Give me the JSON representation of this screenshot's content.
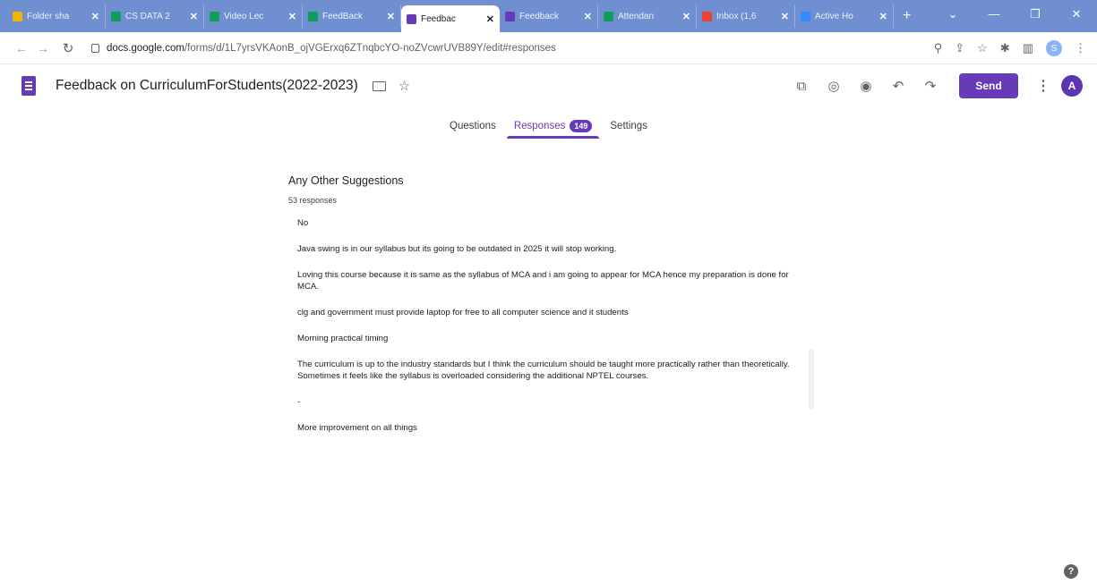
{
  "browser": {
    "tabs": [
      {
        "label": "Folder sha",
        "color": "#f4b400"
      },
      {
        "label": "CS DATA 2",
        "color": "#0f9d58"
      },
      {
        "label": "Video Lec",
        "color": "#0f9d58"
      },
      {
        "label": "FeedBack",
        "color": "#0f9d58"
      },
      {
        "label": "Feedbac",
        "color": "#673ab7",
        "active": true
      },
      {
        "label": "Feedback",
        "color": "#673ab7"
      },
      {
        "label": "Attendan",
        "color": "#0f9d58"
      },
      {
        "label": "Inbox (1,6",
        "color": "#ea4335"
      },
      {
        "label": "Active Ho",
        "color": "#2d8cff"
      }
    ],
    "new_tab": "+",
    "url_host": "docs.google.com",
    "url_path": "/forms/d/1L7yrsVKAonB_ojVGErxq6ZTnqbcYO-noZVcwrUVB89Y/edit#responses",
    "profile_initial": "S"
  },
  "form": {
    "title": "Feedback on CurriculumForStudents(2022-2023)",
    "send_label": "Send",
    "avatar_initial": "A",
    "tabs": {
      "questions": "Questions",
      "responses": "Responses",
      "responses_count": "149",
      "settings": "Settings"
    }
  },
  "question": {
    "title": "Any Other Suggestions",
    "count": "53 responses",
    "answers": [
      "No",
      "Java swing is in our syllabus but its going to be outdated in 2025 it will stop working.",
      "Loving this course because it is same as the syllabus of MCA and i am going to appear for MCA hence my preparation is done for MCA.",
      "clg and government must provide laptop for free to all computer science and it students",
      "Morning practical timing",
      "The curriculum is up to the industry standards but I think the curriculum should be taught more practically rather than theoretically. Sometimes it feels like the syllabus is overloaded considering the additional NPTEL courses.",
      "-",
      "More improvement on all things"
    ]
  },
  "colors": {
    "accent": "#673ab7",
    "tabstrip": "#6f8fd0"
  }
}
